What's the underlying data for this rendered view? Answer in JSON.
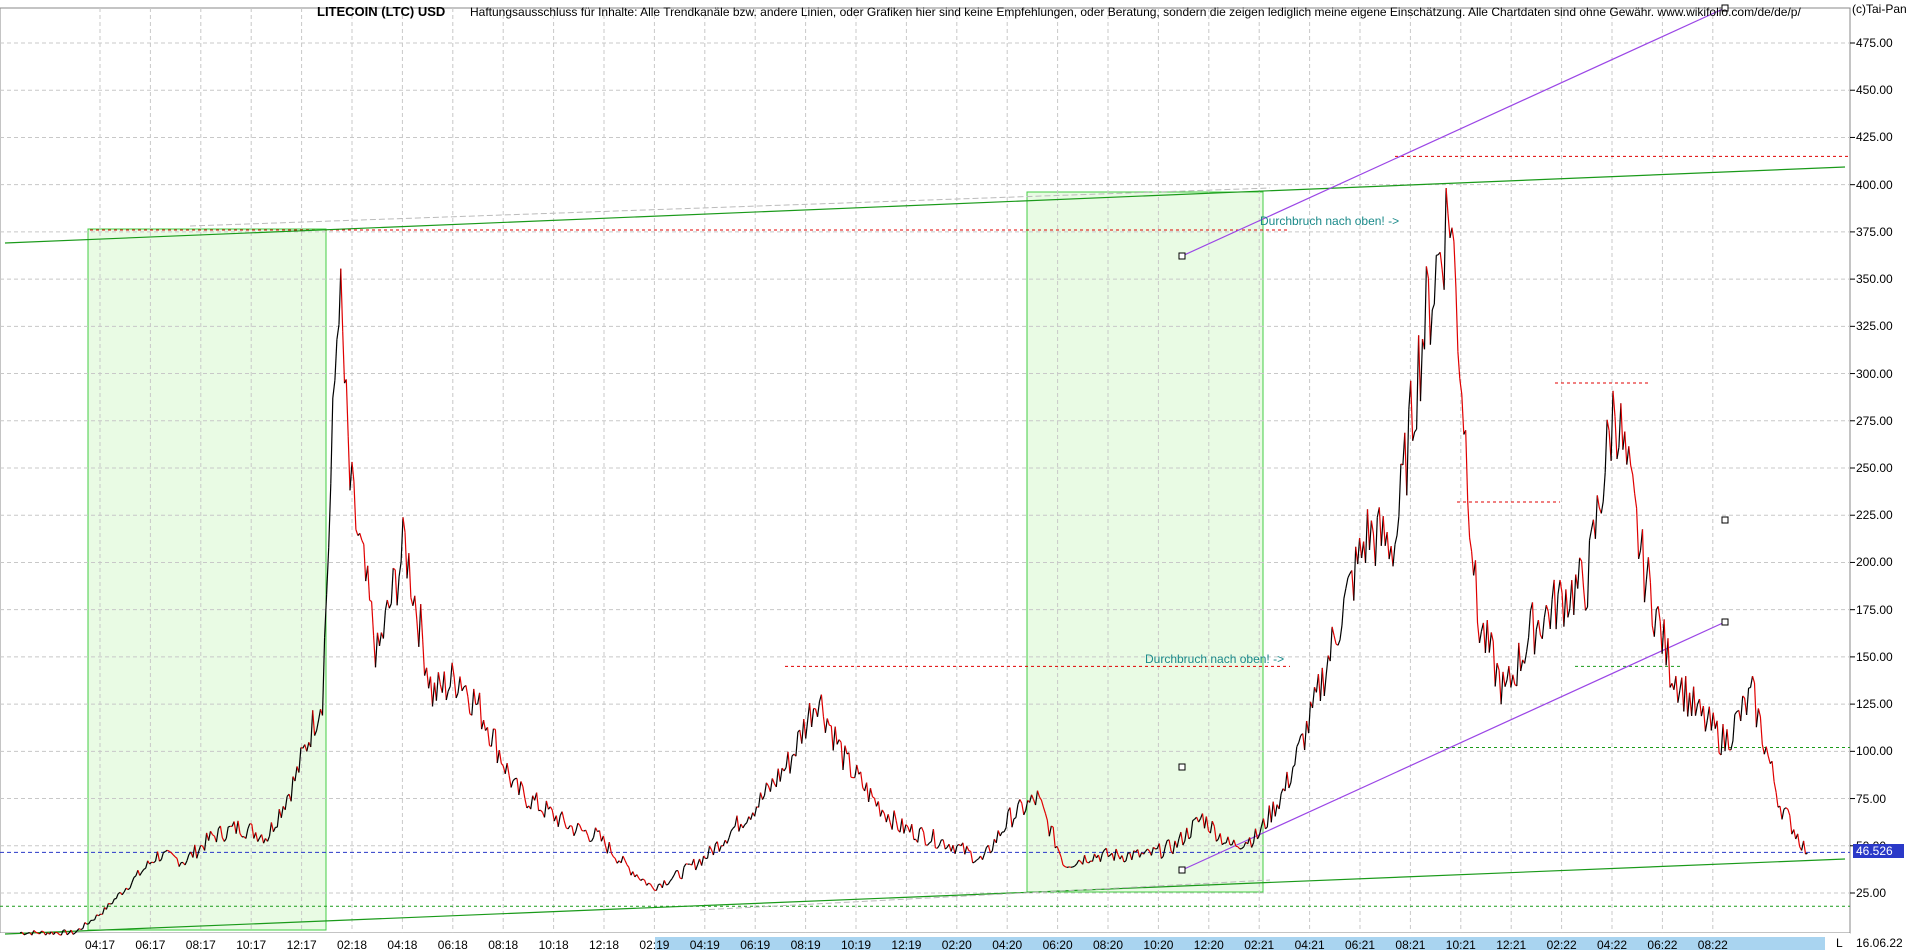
{
  "header": {
    "title": "LITECOIN (LTC) USD",
    "disclaimer": "Haftungsausschluss für Inhalte: Alle Trendkanäle bzw. andere Linien, oder Grafiken hier sind keine Empfehlungen, oder Beratung, sondern die zeigen lediglich meine eigene Einschätzung. Alle Chartdaten sind ohne Gewähr.  www.wikifolio.com/de/de/p/",
    "copyright": "(c)Tai-Pan",
    "end_date": "16.06.22",
    "l_marker": "L"
  },
  "annotations": {
    "breakout_1": "Durchbruch nach oben! ->",
    "breakout_2": "Durchbruch nach oben! ->"
  },
  "last_price": "46.526",
  "colors": {
    "up": "#000000",
    "down": "#e00000",
    "trend_green": "#1a9a1a",
    "channel_purple": "#9b46e6",
    "box_fill": "#e9fbe4",
    "box_border": "#44cc44",
    "level_red": "#e00000",
    "price_blue": "#2a39c8"
  },
  "chart_data": {
    "type": "line",
    "title": "LITECOIN (LTC) USD",
    "xlabel": "",
    "ylabel": "",
    "ylim": [
      5,
      490
    ],
    "grid": true,
    "x_ticks": [
      "04:17",
      "06:17",
      "08:17",
      "10:17",
      "12:17",
      "02:18",
      "04:18",
      "06:18",
      "08:18",
      "10:18",
      "12:18",
      "02:19",
      "04:19",
      "06:19",
      "08:19",
      "10:19",
      "12:19",
      "02:20",
      "04:20",
      "06:20",
      "08:20",
      "10:20",
      "12:20",
      "02:21",
      "04:21",
      "06:21",
      "08:21",
      "10:21",
      "12:21",
      "02:22",
      "04:22",
      "06:22",
      "08:22"
    ],
    "y_ticks": [
      "25.00",
      "50.00",
      "75.00",
      "100.00",
      "125.00",
      "150.00",
      "175.00",
      "200.00",
      "225.00",
      "250.00",
      "275.00",
      "300.00",
      "325.00",
      "350.00",
      "375.00",
      "400.00",
      "425.00",
      "450.00",
      "475.00"
    ],
    "x_start": "2017-01",
    "x_end": "2022-06",
    "series": [
      {
        "x": [
          "2017-01",
          "2017-03",
          "2017-04",
          "2017-05",
          "2017-06",
          "2017-07",
          "2017-08",
          "2017-09",
          "2017-10",
          "2017-11",
          "2017-12",
          "2017-12-20",
          "2018-01",
          "2018-02",
          "2018-03",
          "2018-04",
          "2018-05",
          "2018-06",
          "2018-07",
          "2018-08",
          "2018-09",
          "2018-10",
          "2018-11",
          "2018-12",
          "2019-01",
          "2019-02",
          "2019-03",
          "2019-04",
          "2019-05",
          "2019-06",
          "2019-07",
          "2019-08",
          "2019-09",
          "2019-10",
          "2019-11",
          "2019-12",
          "2020-01",
          "2020-02",
          "2020-03",
          "2020-04",
          "2020-05",
          "2020-06",
          "2020-07",
          "2020-08",
          "2020-09",
          "2020-10",
          "2020-11",
          "2020-12",
          "2021-01",
          "2021-02",
          "2021-03",
          "2021-04",
          "2021-05",
          "2021-06",
          "2021-07",
          "2021-08",
          "2021-09",
          "2021-10",
          "2021-11",
          "2021-12",
          "2022-01",
          "2022-02",
          "2022-03",
          "2022-04",
          "2022-05",
          "2022-06"
        ],
        "values": [
          4,
          4,
          15,
          30,
          45,
          42,
          55,
          60,
          55,
          85,
          130,
          350,
          240,
          150,
          210,
          130,
          140,
          115,
          80,
          70,
          60,
          55,
          40,
          28,
          35,
          45,
          60,
          75,
          95,
          130,
          95,
          75,
          60,
          55,
          50,
          42,
          65,
          75,
          40,
          45,
          45,
          45,
          50,
          65,
          50,
          55,
          80,
          120,
          170,
          215,
          210,
          320,
          390,
          170,
          130,
          165,
          180,
          190,
          285,
          200,
          145,
          120,
          105,
          130,
          72,
          46
        ]
      }
    ],
    "levels": [
      376,
      145,
      415,
      295,
      232,
      102,
      46.526
    ]
  }
}
